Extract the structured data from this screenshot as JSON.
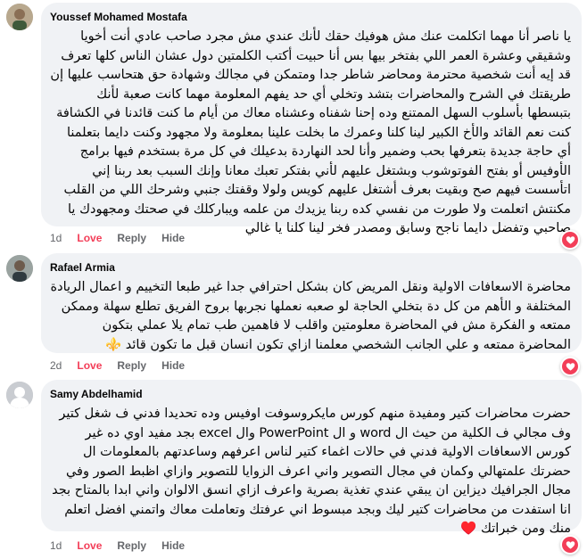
{
  "accent_color": "#f33e58",
  "comments": [
    {
      "author": "Youssef Mohamed Mostafa",
      "text": "يا ناصر أنا مهما اتكلمت عنك مش هوفيك حقك لأنك عندي مش مجرد صاحب عادي أنت أخويا وشقيقي وعشرة العمر اللي بفتخر بيها بس أنا حبيت أكتب الكلمتين دول عشان الناس كلها تعرف قد إيه أنت شخصية محترمة ومحاضر شاطر جدا ومتمكن في مجالك وشهادة حق هتحاسب عليها إن طريقتك في الشرح والمحاضرات بتشد وتخلي أي حد يفهم المعلومة مهما كانت صعبة لأنك بتبسطها بأسلوب السهل الممتنع وده إحنا شفناه وعشناه معاك من أيام ما كنت قائدنا في الكشافة كنت نعم القائد والأخ الكبير لينا كلنا وعمرك ما بخلت علينا بمعلومة ولا مجهود وكنت دايما بتعلمنا أي حاجة جديدة بتعرفها بحب وضمير وأنا لحد النهاردة بدعيلك في كل مرة بستخدم فيها برامج الأوفيس أو بفتح الفوتوشوب وبشتغل عليهم لأني بفتكر تعبك معانا وإنك السبب بعد ربنا إني اتأسست فيهم صح وبقيت بعرف أشتغل عليهم كويس ولولا وقفتك جنبي وشرحك اللي من القلب مكنتش اتعلمت ولا طورت من نفسي كده ربنا يزيدك من علمه ويباركلك في صحتك ومجهودك يا صاحبي وتفضل دايما ناجح وسابق ومصدر فخر لينا كلنا يا غالي",
      "time": "1d",
      "love_label": "Love",
      "reply_label": "Reply",
      "hide_label": "Hide"
    },
    {
      "author": "Rafael Armia",
      "text": "محاضرة الاسعافات الاولية ونقل المريض كان بشكل احترافي جدا غير طبعا التخييم و اعمال الريادة المختلفة و الأهم من كل دة بتخلي الحاجة لو صعبه نعملها نجربها بروح الفريق تطلع سهلة وممكن ممتعه و الفكرة مش في المحاضرة معلومتين واقلب لا فاهمين طب تمام يلا عملي بتكون المحاضرة ممتعه و علي الجانب الشخصي معلمنا ازاي تكون انسان قبل ما تكون قائد ⚜️",
      "time": "2d",
      "love_label": "Love",
      "reply_label": "Reply",
      "hide_label": "Hide"
    },
    {
      "author": "Samy Abdelhamid",
      "text": "حضرت محاضرات كتير ومفيدة منهم كورس مايكروسوفت اوفيس وده تحديدا فدني ف شغل كتير وف مجالي ف الكلية من حيث ال word و ال PowerPoint وال excel بجد مفيد اوي ده غير كورس الاسعافات الاولية فدني في حالات اغماء كتير لناس اعرفهم وساعدتهم بالمعلومات ال حضرتك علمتهالي وكمان في مجال التصوير واني اعرف الزوايا للتصوير وازاي اظبط الصور وفي مجال الجرافيك ديزاين ان يبقي عندي تغذية بصرية واعرف ازاي انسق الالوان واني ابدا بالمتاح بجد انا استفدت من محاضرات كتير ليك وبجد مبسوط اني عرفتك وتعاملت معاك واتمني افضل اتعلم منك ومن خبراتك ♥️",
      "time": "1d",
      "love_label": "Love",
      "reply_label": "Reply",
      "hide_label": "Hide"
    }
  ]
}
